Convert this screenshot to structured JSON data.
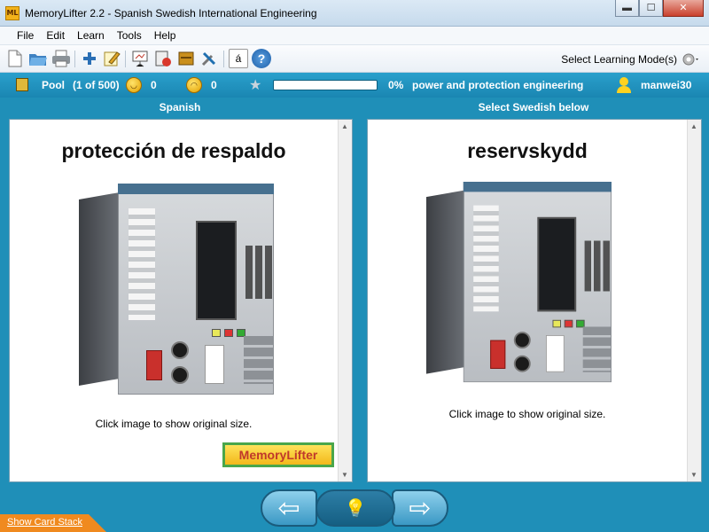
{
  "window": {
    "app_icon_text": "ML",
    "title": "MemoryLifter 2.2 - Spanish Swedish International Engineering",
    "min_glyph": "▬",
    "max_glyph": "☐",
    "close_glyph": "✕"
  },
  "menu": [
    "File",
    "Edit",
    "Learn",
    "Tools",
    "Help"
  ],
  "toolbar": {
    "select_mode_label": "Select Learning Mode(s)",
    "char_button": "á",
    "help_button": "?"
  },
  "status": {
    "pool_label": "Pool",
    "pool_count": "(1 of 500)",
    "score_good": "0",
    "score_bad": "0",
    "progress_fraction": 0.0,
    "progress_percent": "0%",
    "chapter": "power and protection engineering",
    "username": "manwei30"
  },
  "question": {
    "language_label": "Spanish",
    "word": "protección de respaldo",
    "caption": "Click image to show original size."
  },
  "answer": {
    "language_label": "Select Swedish below",
    "word": "reservskydd",
    "caption": "Click image to show original size."
  },
  "logo": {
    "text": "MemoryLifter"
  },
  "nav": {
    "prev_glyph": "⇦",
    "hint_glyph": "💡",
    "next_glyph": "⇨"
  },
  "show_card_stack": "Show Card Stack",
  "colors": {
    "status_bar": "#1f8fb8",
    "logo_red": "#c0392b",
    "stack_tab": "#f08a1f"
  }
}
